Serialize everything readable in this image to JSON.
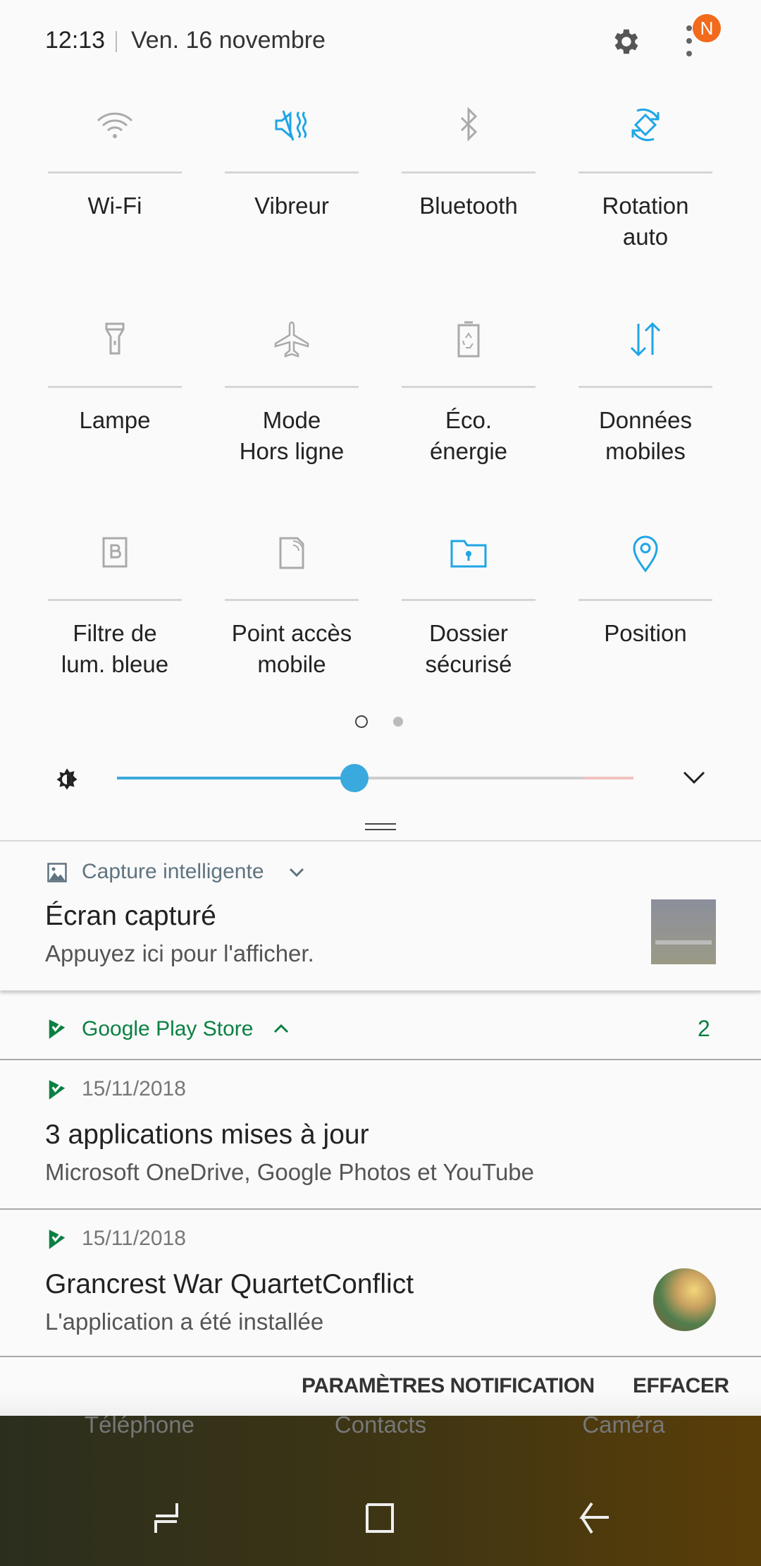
{
  "status": {
    "time": "12:13",
    "date": "Ven. 16 novembre",
    "badge": "N",
    "badge_color": "#f26a1b"
  },
  "accent": "#1ea5e6",
  "tiles": [
    {
      "label": "Wi-Fi",
      "icon": "wifi-icon",
      "active": false
    },
    {
      "label": "Vibreur",
      "icon": "vibrate-icon",
      "active": true
    },
    {
      "label": "Bluetooth",
      "icon": "bluetooth-icon",
      "active": false
    },
    {
      "label": "Rotation\nauto",
      "icon": "rotation-icon",
      "active": true
    },
    {
      "label": "Lampe",
      "icon": "flashlight-icon",
      "active": false
    },
    {
      "label": "Mode\nHors ligne",
      "icon": "airplane-icon",
      "active": false
    },
    {
      "label": "Éco.\nénergie",
      "icon": "battery-saver-icon",
      "active": false
    },
    {
      "label": "Données\nmobiles",
      "icon": "mobile-data-icon",
      "active": true
    },
    {
      "label": "Filtre de\nlum. bleue",
      "icon": "blue-light-filter-icon",
      "active": false
    },
    {
      "label": "Point accès\nmobile",
      "icon": "hotspot-icon",
      "active": false
    },
    {
      "label": "Dossier\nsécurisé",
      "icon": "secure-folder-icon",
      "active": true
    },
    {
      "label": "Position",
      "icon": "location-icon",
      "active": true
    }
  ],
  "pager": {
    "current": 1,
    "total": 2
  },
  "brightness": {
    "value_percent": 46
  },
  "capture": {
    "app": "Capture intelligente",
    "title": "Écran capturé",
    "text": "Appuyez ici pour l'afficher."
  },
  "playstore": {
    "app": "Google Play Store",
    "count": "2",
    "color": "#0b8043",
    "items": [
      {
        "date": "15/11/2018",
        "title": "3 applications mises à jour",
        "text": "Microsoft OneDrive, Google Photos et YouTube"
      },
      {
        "date": "15/11/2018",
        "title": "Grancrest War QuartetConflict",
        "text": "L'application a été installée"
      }
    ]
  },
  "footer": {
    "settings": "PARAMÈTRES NOTIFICATION",
    "clear": "EFFACER"
  },
  "dock": [
    "Téléphone",
    "Contacts",
    "Caméra"
  ]
}
